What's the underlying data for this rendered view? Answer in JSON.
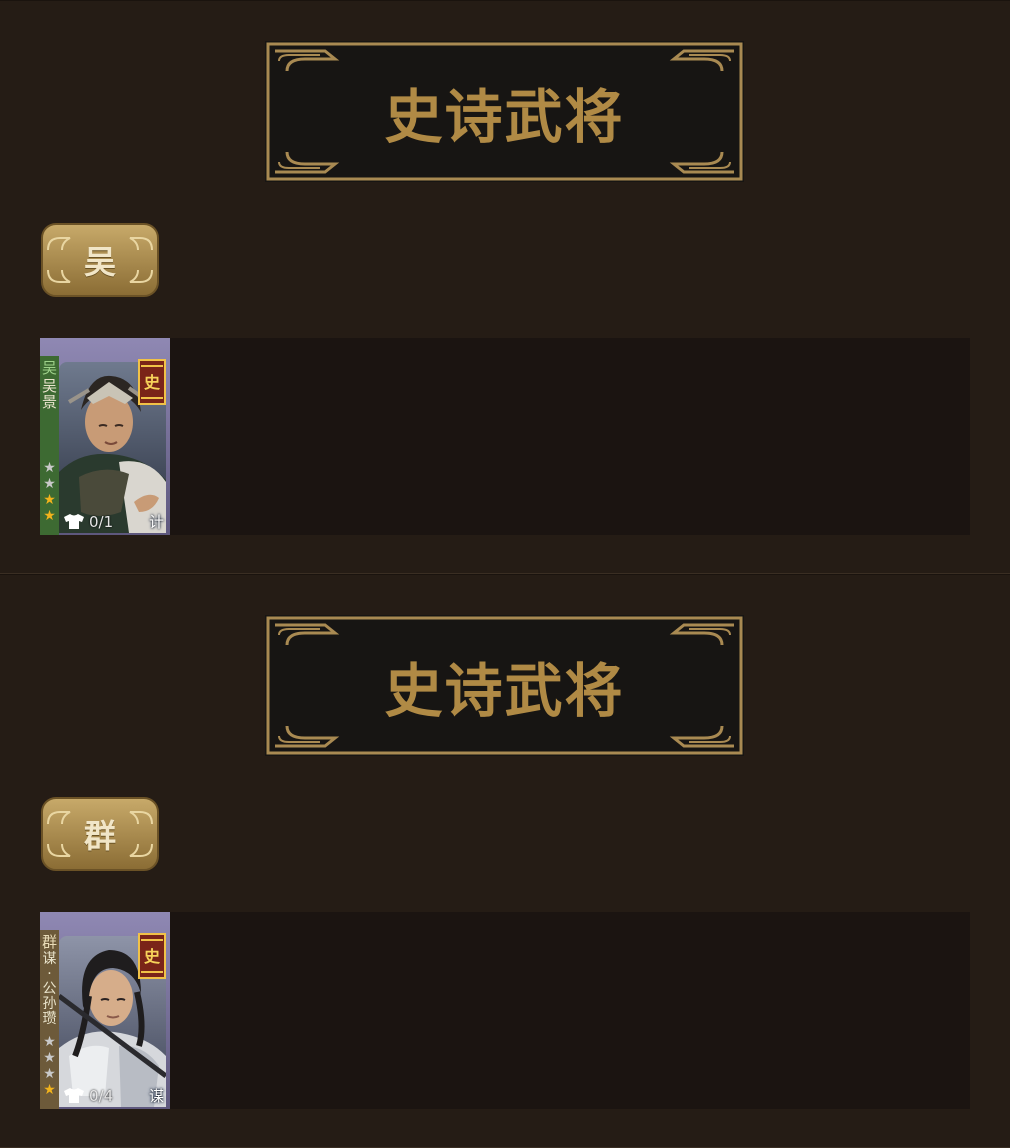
{
  "sections": [
    {
      "title": "史诗武将",
      "faction": "吴",
      "card": {
        "faction_short": "吴",
        "name": "吴景",
        "stars": [
          false,
          false,
          true,
          true
        ],
        "count": "0/1",
        "role": "计"
      }
    },
    {
      "title": "史诗武将",
      "faction": "群",
      "card": {
        "faction_short": "群",
        "name": "谋·公孙瓒",
        "stars": [
          false,
          false,
          false,
          true
        ],
        "count": "0/4",
        "role": "谋"
      }
    }
  ],
  "icons": {
    "epic_badge": "epic-rank-icon",
    "shirt": "shirt-icon",
    "star": "star-icon"
  },
  "colors": {
    "background": "#251c15",
    "gold": "#b08a45",
    "banner": "#171513",
    "row": "#1b1411"
  }
}
